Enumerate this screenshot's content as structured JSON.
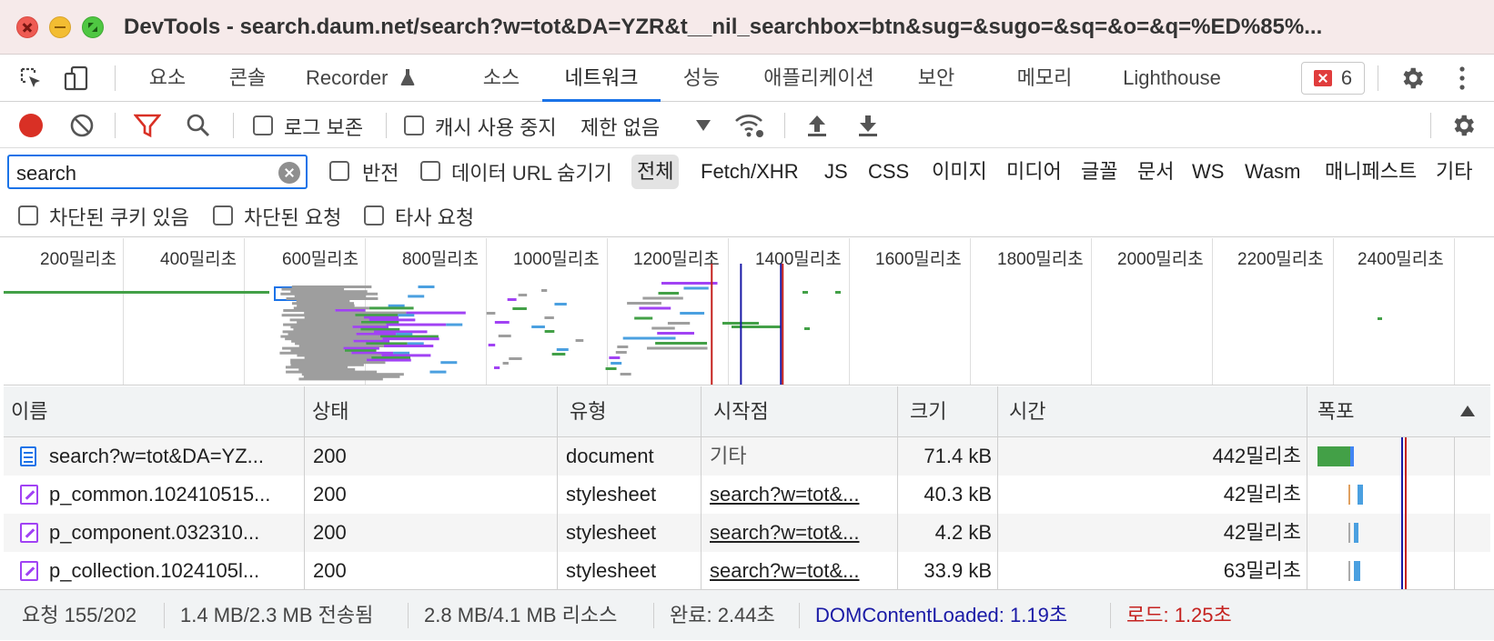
{
  "window": {
    "title": "DevTools - search.daum.net/search?w=tot&DA=YZR&t__nil_searchbox=btn&sug=&sugo=&sq=&o=&q=%ED%85%..."
  },
  "tabs": [
    {
      "label": "요소"
    },
    {
      "label": "콘솔"
    },
    {
      "label": "Recorder"
    },
    {
      "label": "소스"
    },
    {
      "label": "네트워크",
      "active": true
    },
    {
      "label": "성능"
    },
    {
      "label": "애플리케이션"
    },
    {
      "label": "보안"
    },
    {
      "label": "메모리"
    },
    {
      "label": "Lighthouse"
    }
  ],
  "error_count": "6",
  "toolbar": {
    "preserve_log_label": "로그 보존",
    "disable_cache_label": "캐시 사용 중지",
    "throttle_value": "제한 없음"
  },
  "filter": {
    "search_value": "search",
    "invert_label": "반전",
    "hide_data_url_label": "데이터 URL 숨기기",
    "types": [
      "전체",
      "Fetch/XHR",
      "JS",
      "CSS",
      "이미지",
      "미디어",
      "글꼴",
      "문서",
      "WS",
      "Wasm",
      "매니페스트",
      "기타"
    ],
    "active_type": "전체",
    "blocked_cookies_label": "차단된 쿠키 있음",
    "blocked_requests_label": "차단된 요청",
    "third_party_label": "타사 요청"
  },
  "overview": {
    "ticks": [
      "200밀리초",
      "400밀리초",
      "600밀리초",
      "800밀리초",
      "1000밀리초",
      "1200밀리초",
      "1400밀리초",
      "1600밀리초",
      "1800밀리초",
      "2000밀리초",
      "2200밀리초",
      "2400밀리초"
    ],
    "dom_content_loaded_ms": 1190,
    "load_ms": 1250
  },
  "table": {
    "columns": [
      "이름",
      "상태",
      "유형",
      "시작점",
      "크기",
      "시간",
      "폭포"
    ],
    "rows": [
      {
        "name": "search?w=tot&DA=YZ...",
        "status": "200",
        "type": "document",
        "initiator": "기타",
        "size": "71.4 kB",
        "time": "442밀리초",
        "icon": "document-icon"
      },
      {
        "name": "p_common.102410515...",
        "status": "200",
        "type": "stylesheet",
        "initiator": "search?w=tot&...",
        "size": "40.3 kB",
        "time": "42밀리초",
        "icon": "stylesheet-icon"
      },
      {
        "name": "p_component.032310...",
        "status": "200",
        "type": "stylesheet",
        "initiator": "search?w=tot&...",
        "size": "4.2 kB",
        "time": "42밀리초",
        "icon": "stylesheet-icon"
      },
      {
        "name": "p_collection.1024105l...",
        "status": "200",
        "type": "stylesheet",
        "initiator": "search?w=tot&...",
        "size": "33.9 kB",
        "time": "63밀리초",
        "icon": "stylesheet-icon"
      }
    ]
  },
  "status": {
    "requests": "요청 155/202",
    "transferred": "1.4 MB/2.3 MB 전송됨",
    "resources": "2.8 MB/4.1 MB 리소스",
    "finish": "완료: 2.44초",
    "dom_content_loaded": "DOMContentLoaded: 1.19초",
    "load": "로드: 1.25초"
  },
  "colors": {
    "accent": "#1a73e8",
    "dcl_line": "#1a1aa6",
    "load_line": "#c5221f",
    "record": "#d93025"
  }
}
